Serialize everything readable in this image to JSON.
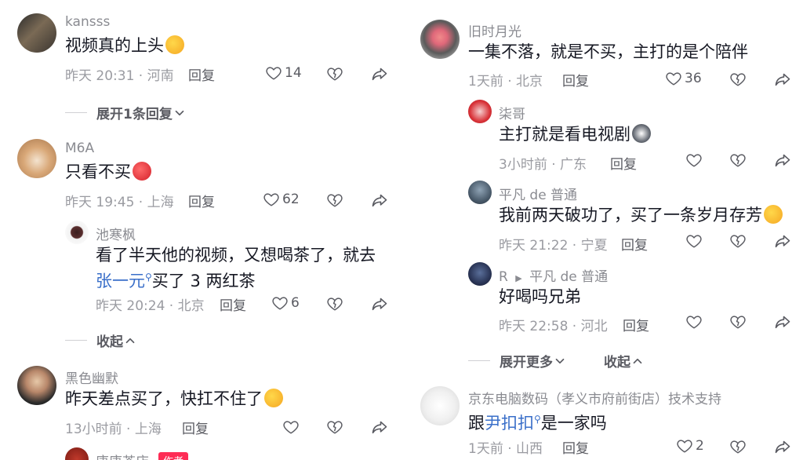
{
  "left": {
    "c1": {
      "user": "kansss",
      "text": "视频真的上头",
      "time": "昨天 20:31 · 河南",
      "reply": "回复",
      "likes": "14",
      "expand": "展开1条回复"
    },
    "c2": {
      "user": "M6A",
      "text": "只看不买",
      "time": "昨天 19:45 · 上海",
      "reply": "回复",
      "likes": "62"
    },
    "c2r1": {
      "user": "池寒枫",
      "text_line1": "看了半天他的视频，又想喝茶了，就去",
      "mention": "张一元",
      "text_line2": "买了 3 两红茶",
      "time": "昨天 20:24 · 北京",
      "reply": "回复",
      "likes": "6",
      "collapse": "收起"
    },
    "c3": {
      "user": "黑色幽默",
      "text": "昨天差点买了，快扛不住了",
      "time": "13小时前 · 上海",
      "reply": "回复"
    },
    "c4": {
      "user": "唐唐茶店",
      "badge": "作者"
    }
  },
  "right": {
    "c1": {
      "user": "旧时月光",
      "text": "一集不落，就是不买，主打的是个陪伴",
      "time": "1天前 · 北京",
      "reply": "回复",
      "likes": "36"
    },
    "r1": {
      "user": "柒哥",
      "text": "主打就是看电视剧",
      "time": "3小时前 · 广东",
      "reply": "回复"
    },
    "r2": {
      "user": "平凡 de 普通",
      "text": "我前两天破功了，买了一条岁月存芳",
      "time": "昨天 21:22 · 宁夏",
      "reply": "回复"
    },
    "r3": {
      "user_from": "R",
      "user_to": "平凡 de 普通",
      "text": "好喝吗兄弟",
      "time": "昨天 22:58 · 河北",
      "reply": "回复"
    },
    "expand_more": "展开更多",
    "collapse": "收起",
    "c2": {
      "user": "京东电脑数码（孝义市府前街店）技术支持",
      "text_pre": "跟",
      "mention": "尹扣扣",
      "text_post": "是一家吗",
      "time": "1天前 · 山西",
      "reply": "回复",
      "likes": "2"
    }
  },
  "icons": {
    "like": "heart-outline-icon",
    "dislike": "broken-heart-icon",
    "share": "share-arrow-icon",
    "chevron_down": "chevron-down-icon",
    "chevron_up": "chevron-up-icon"
  },
  "colors": {
    "mention": "#3a6fc9",
    "badge": "#fe2c55"
  }
}
